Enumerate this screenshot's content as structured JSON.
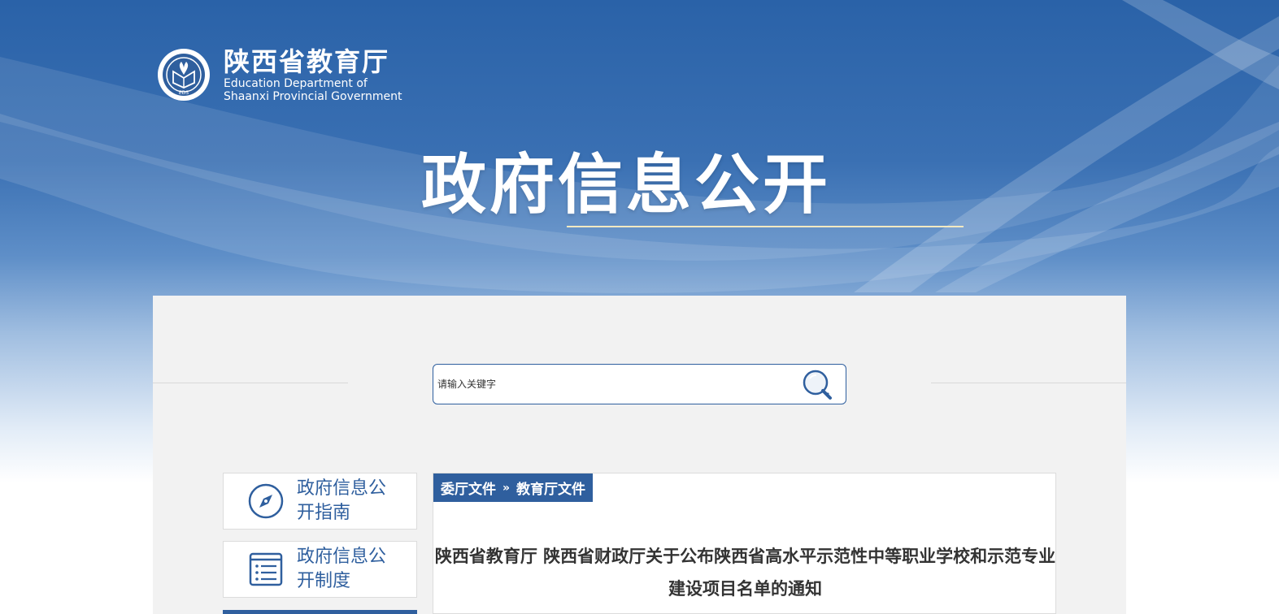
{
  "header": {
    "org_name_cn": "陕西省教育厅",
    "org_name_en_line1": "Education Department of",
    "org_name_en_line2": "Shaanxi Provincial Government",
    "emblem_text": "EDS",
    "hero_title": "政府信息公开"
  },
  "search": {
    "placeholder": "请输入关键字",
    "button_icon": "search-icon"
  },
  "sidebar": {
    "items": [
      {
        "label": "政府信息公开指南",
        "icon": "compass-icon"
      },
      {
        "label": "政府信息公开制度",
        "icon": "document-list-icon"
      }
    ]
  },
  "breadcrumb": {
    "parent": "委厅文件",
    "separator": "»",
    "current": "教育厅文件"
  },
  "article": {
    "title": "陕西省教育厅 陕西省财政厅关于公布陕西省高水平示范性中等职业学校和示范专业建设项目名单的通知"
  },
  "colors": {
    "brand_blue": "#2f5f9e",
    "panel_bg": "#f2f2f2",
    "hero_underline": "#f3e9c2"
  }
}
